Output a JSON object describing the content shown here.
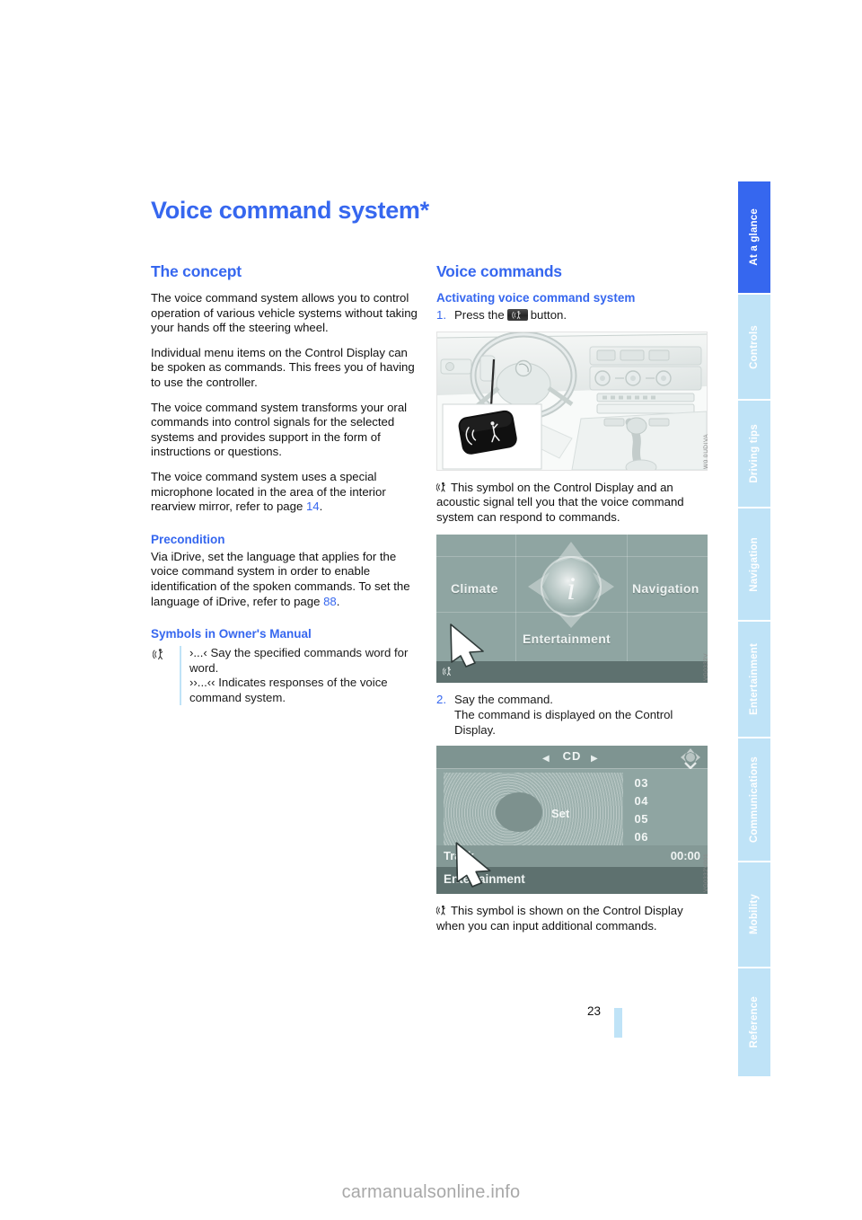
{
  "page": {
    "title": "Voice command system*",
    "number": "23",
    "watermark": "carmanualsonline.info"
  },
  "sidebar": {
    "active_index": 0,
    "active_color": "#3667ef",
    "inactive_color": "#bfe3f7",
    "items": [
      {
        "label": "At a glance"
      },
      {
        "label": "Controls"
      },
      {
        "label": "Driving tips"
      },
      {
        "label": "Navigation"
      },
      {
        "label": "Entertainment"
      },
      {
        "label": "Communications"
      },
      {
        "label": "Mobility"
      },
      {
        "label": "Reference"
      }
    ]
  },
  "left_column": {
    "concept": {
      "heading": "The concept",
      "paragraphs": [
        "The voice command system allows you to control operation of various vehicle systems without taking your hands off the steering wheel.",
        "Individual menu items on the Control Display can be spoken as commands. This frees you of having to use the controller.",
        "The voice command system transforms your oral commands into control signals for the selected systems and provides support in the form of instructions or questions."
      ],
      "mic_paragraph_pre": "The voice command system uses a special microphone located in the area of the interior rearview mirror, refer to page ",
      "mic_paragraph_ref": "14",
      "mic_paragraph_post": "."
    },
    "precondition": {
      "heading": "Precondition",
      "text_pre": "Via iDrive, set the language that applies for the voice command system in order to enable identification of the spoken commands. To set the language of iDrive, refer to page ",
      "text_ref": "88",
      "text_post": "."
    },
    "symbols": {
      "heading": "Symbols in Owner's Manual",
      "icon_name": "speaking-person-icon",
      "line1": "›...‹ Say the specified commands word for word.",
      "line2": "››...‹‹ Indicates responses of the voice command system."
    }
  },
  "right_column": {
    "heading": "Voice commands",
    "activating": {
      "heading": "Activating voice command system",
      "step1_num": "1.",
      "step1_pre": "Press the",
      "step1_post": "button.",
      "step1_button_icon": "voice-command-button-icon",
      "step2_num": "2.",
      "step2_line1": "Say the command.",
      "step2_line2": "The command is displayed on the Control Display."
    },
    "figure_interior": {
      "name": "car-interior-voice-button-illustration",
      "code": "W0 0\u0001UDI\u0001VA"
    },
    "caption1": "This symbol on the Control Display and an acoustic signal tell you that the voice command system can respond to commands.",
    "figure_idrive": {
      "name": "idrive-main-menu-screenshot",
      "cells": {
        "left": "Climate",
        "right": "Navigation",
        "bottom": "Entertainment",
        "center_icon": "information-icon"
      },
      "code": "VG0332V"
    },
    "figure_cd": {
      "name": "cd-playback-screenshot",
      "title": "CD",
      "set_label": "Set",
      "tracks": [
        "03",
        "04",
        "05",
        "06"
      ],
      "track_label": "Track",
      "time": "00:00",
      "menu_label": "Entertainment",
      "code": "VG0332V001"
    },
    "caption2": "This symbol is shown on the Control Display when you can input additional commands."
  }
}
